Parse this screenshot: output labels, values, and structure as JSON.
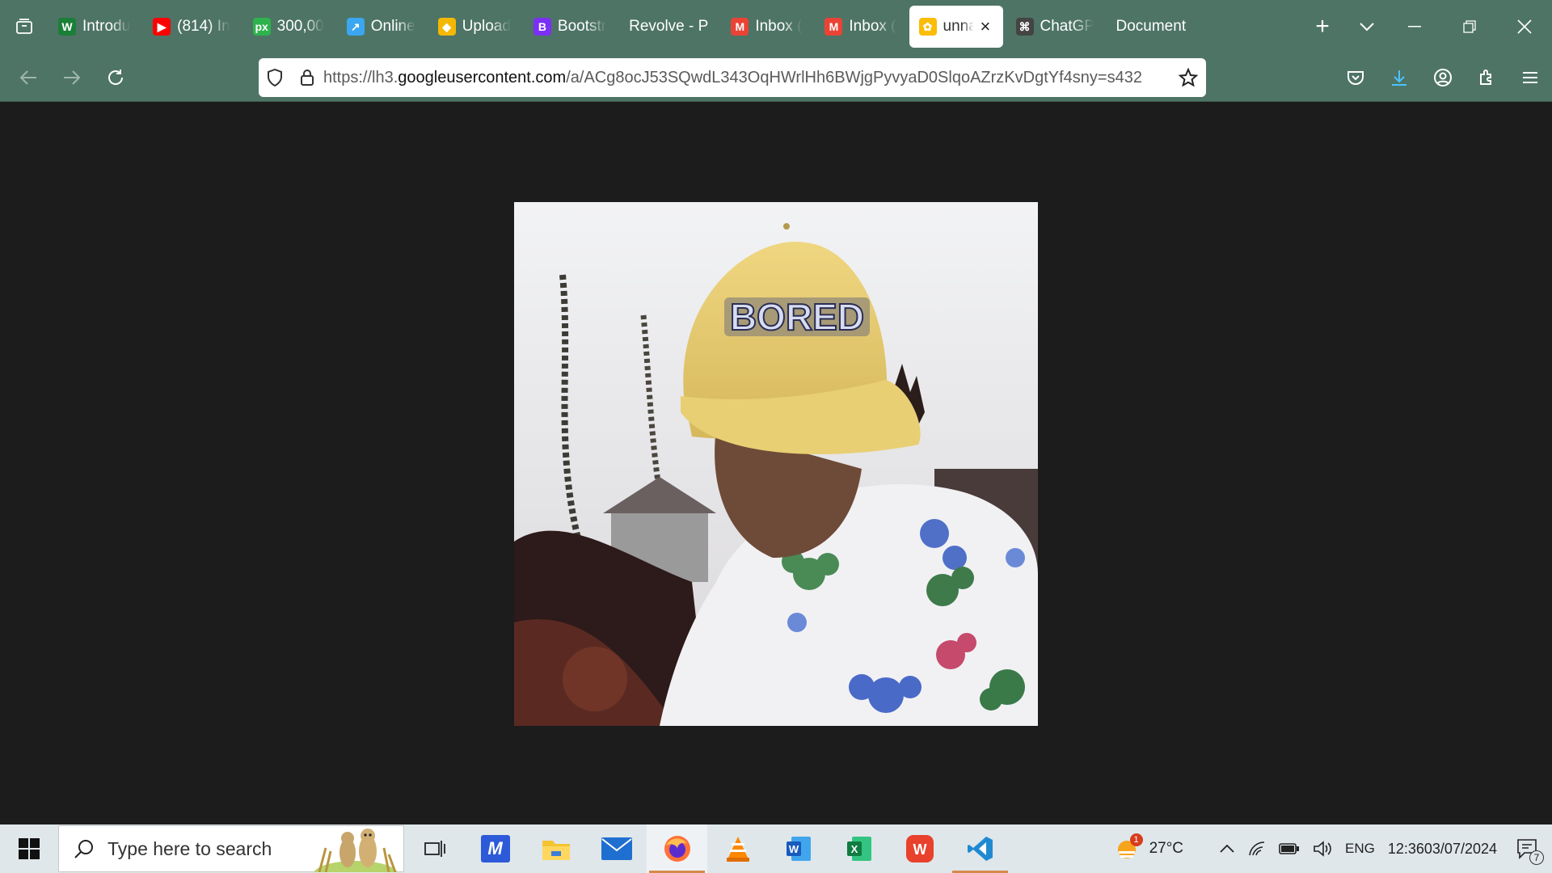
{
  "browser": {
    "tabs": [
      {
        "label": "Introdu",
        "icon": "w-brand-icon",
        "color": "#1a7f37",
        "glyph": "W"
      },
      {
        "label": "(814) In",
        "icon": "youtube-icon",
        "color": "#ff0000",
        "glyph": "▶"
      },
      {
        "label": "300,00",
        "icon": "pixabay-icon",
        "color": "#2eb34c",
        "glyph": "px"
      },
      {
        "label": "Online",
        "icon": "arrow-app-icon",
        "color": "#3aa7f0",
        "glyph": "↗"
      },
      {
        "label": "Upload",
        "icon": "upload-app-icon",
        "color": "#f5b800",
        "glyph": "◆"
      },
      {
        "label": "Bootstr",
        "icon": "bootstrap-icon",
        "color": "#7b2ff7",
        "glyph": "B"
      },
      {
        "label": "Revolve - P",
        "icon": "",
        "color": "",
        "glyph": ""
      },
      {
        "label": "Inbox (",
        "icon": "gmail-icon",
        "color": "#ea4335",
        "glyph": "M"
      },
      {
        "label": "Inbox (",
        "icon": "gmail-icon",
        "color": "#ea4335",
        "glyph": "M"
      },
      {
        "label": "unna",
        "icon": "google-photos-icon",
        "color": "#fbbc04",
        "glyph": "✿",
        "active": true
      },
      {
        "label": "ChatGP",
        "icon": "chatgpt-icon",
        "color": "#444",
        "glyph": "⌘"
      },
      {
        "label": "Document",
        "icon": "",
        "color": "",
        "glyph": ""
      }
    ],
    "url": {
      "prefix": "https://lh3.",
      "domain": "googleusercontent.com",
      "path": "/a/ACg8ocJ53SQwdL343OqHWrlHh6BWjgPyvyaD0SlqoAZrzKvDgtYf4sny=s432"
    }
  },
  "photo": {
    "cap_text": "BORED"
  },
  "taskbar": {
    "search_placeholder": "Type here to search",
    "weather": {
      "temp": "27°C",
      "badge": "1"
    },
    "language": "ENG",
    "time": "12:36",
    "date": "03/07/2024",
    "notifications": "7"
  },
  "colors": {
    "chrome": "#4e7466",
    "page_bg": "#1c1c1c",
    "taskbar": "#dfe7ea"
  }
}
